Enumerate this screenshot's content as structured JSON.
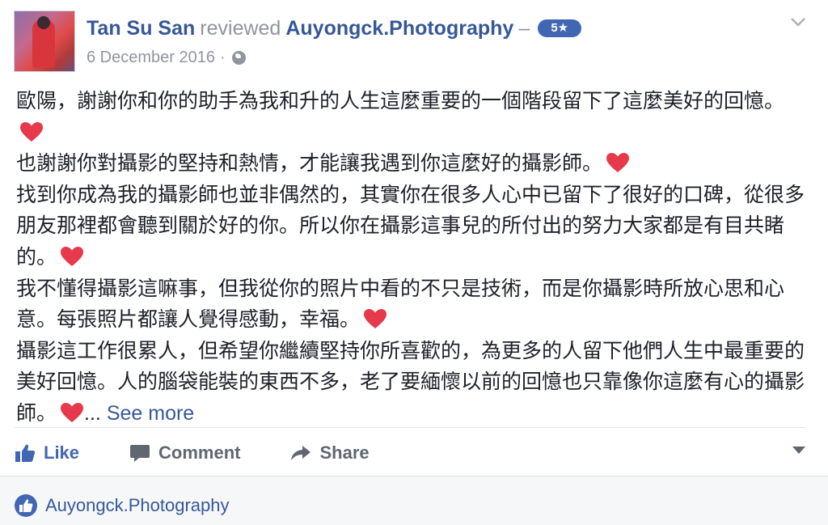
{
  "post": {
    "author": "Tan Su San",
    "verb": "reviewed",
    "page": "Auyongck.Photography",
    "dash": "–",
    "rating": "5★",
    "date": "6 December 2016",
    "date_sep": "·",
    "privacy_icon": "globe-icon",
    "menu_icon": "chevron-down-icon"
  },
  "review": {
    "paragraphs": [
      "歐陽，謝謝你和你的助手為我和升的人生這麼重要的一個階段留下了這麼美好的回憶。",
      "也謝謝你對攝影的堅持和熱情，才能讓我遇到你這麼好的攝影師。",
      "找到你成為我的攝影師也並非偶然的，其實你在很多人心中已留下了很好的口碑，從很多朋友那裡都會聽到關於好的你。所以你在攝影這事兒的所付出的努力大家都是有目共睹的。",
      "我不懂得攝影這嘛事，但我從你的照片中看的不只是技術，而是你攝影時所放心思和心意。每張照片都讓人覺得感動，幸福。",
      "攝影這工作很累人，但希望你繼續堅持你所喜歡的，為更多的人留下他們人生中最重要的美好回憶。人的腦袋能裝的東西不多，老了要緬懷以前的回憶也只靠像你這麼有心的攝影師。"
    ],
    "ellipsis": "...",
    "see_more": "See more",
    "emoji_icon": "heart-icon",
    "emoji_color": "#e6394b"
  },
  "actions": {
    "like": "Like",
    "comment": "Comment",
    "share": "Share"
  },
  "footer": {
    "page_name": "Auyongck.Photography"
  },
  "colors": {
    "link": "#365899",
    "accent": "#4267b2",
    "muted": "#90949c"
  }
}
